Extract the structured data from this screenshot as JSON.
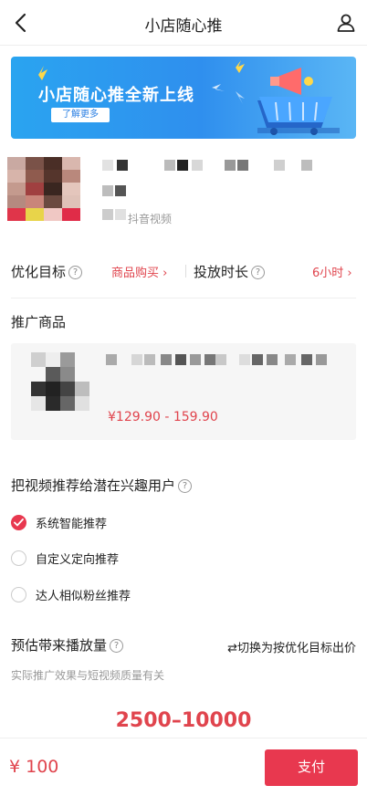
{
  "header": {
    "title": "小店随心推",
    "back_icon": "chevron-left-icon",
    "user_icon": "user-icon"
  },
  "banner": {
    "headline": "小店随心推全新上线",
    "button_label": "了解更多",
    "accent": "#2f8fee"
  },
  "video": {
    "source": "抖音视频"
  },
  "optimize": {
    "goal_label": "优化目标",
    "goal_value": "商品购买 ›",
    "duration_label": "投放时长",
    "duration_value": "6小时 ›"
  },
  "product_section": {
    "title": "推广商品",
    "price_range": "¥129.90 - 159.90"
  },
  "audience": {
    "title": "把视频推荐给潜在兴趣用户",
    "options": [
      {
        "label": "系统智能推荐",
        "selected": true
      },
      {
        "label": "自定义定向推荐",
        "selected": false
      },
      {
        "label": "达人相似粉丝推荐",
        "selected": false
      }
    ]
  },
  "estimate": {
    "title": "预估带来播放量",
    "switch_link": "⇄切换为按优化目标出价",
    "note": "实际推广效果与短视频质量有关",
    "value": "2500–10000"
  },
  "footer": {
    "total": "¥ 100",
    "pay_label": "支付"
  },
  "colors": {
    "primary_red": "#e8384f",
    "price_red": "#e0444d",
    "banner_blue": "#2f8fee"
  }
}
